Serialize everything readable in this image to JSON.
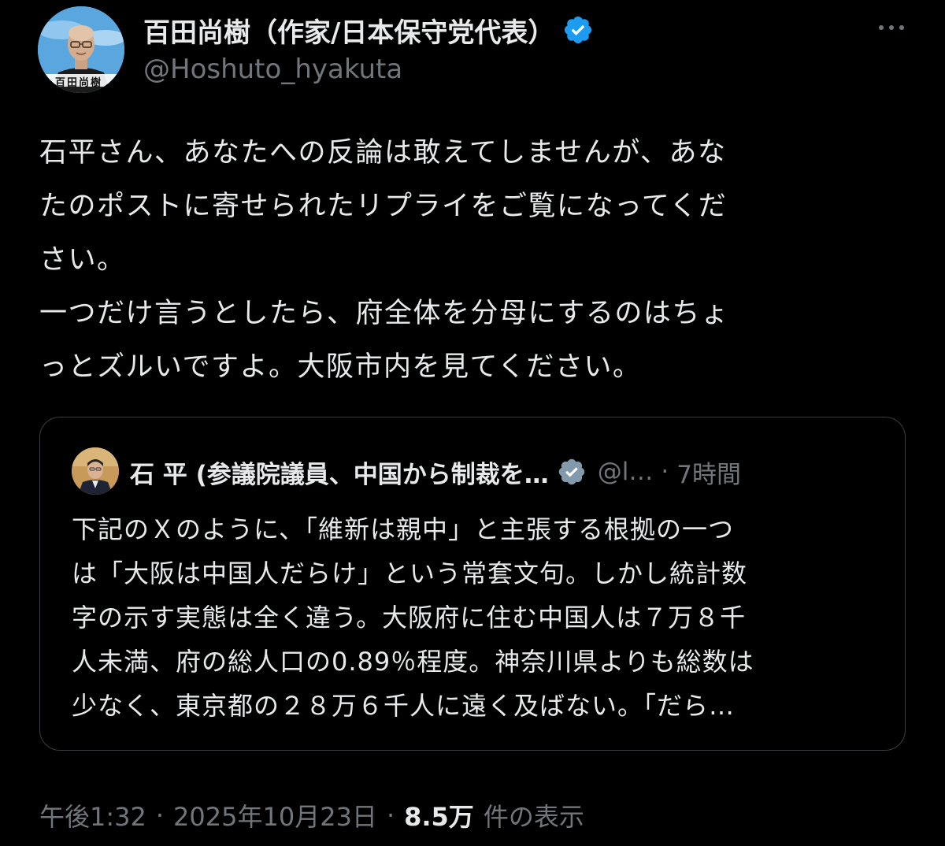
{
  "post": {
    "author": {
      "display_name": "百田尚樹（作家/日本保守党代表）",
      "handle": "@Hoshuto_hyakuta",
      "avatar_caption": "百田尚樹",
      "verified": true,
      "verified_color": "#1d9bf0"
    },
    "more_icon": "more-horizontal-icon",
    "text_lines": [
      "石平さん、あなたへの反論は敢えてしませんが、あな",
      "たのポストに寄せられたリプライをご覧になってくだ",
      "さい。",
      "一つだけ言うとしたら、府全体を分母にするのはちょ",
      "っとズルいですよ。大阪市内を見てください。"
    ],
    "quote": {
      "author_name": "石 平 (参議院議員、中国から制裁を…",
      "handle": "@l…",
      "separator": "·",
      "time": "7時間",
      "verified": true,
      "verified_color": "#829aab",
      "text_lines": [
        "下記のＸのように、「維新は親中」と主張する根拠の一つ",
        "は「大阪は中国人だらけ」という常套文句。しかし統計数",
        "字の示す実態は全く違う。大阪府に住む中国人は７万８千",
        "人未満、府の総人口の0.89％程度。神奈川県よりも総数は",
        "少なく、東京都の２８万６千人に遠く及ばない。「だら…"
      ]
    },
    "meta": {
      "time": "午後1:32",
      "separator": "·",
      "date": "2025年10月23日",
      "views_count": "8.5万",
      "views_label": "件の表示"
    }
  },
  "colors": {
    "background": "#000000",
    "primary_text": "#e7e9ea",
    "secondary_text": "#71767b",
    "border": "#3a3d41"
  }
}
